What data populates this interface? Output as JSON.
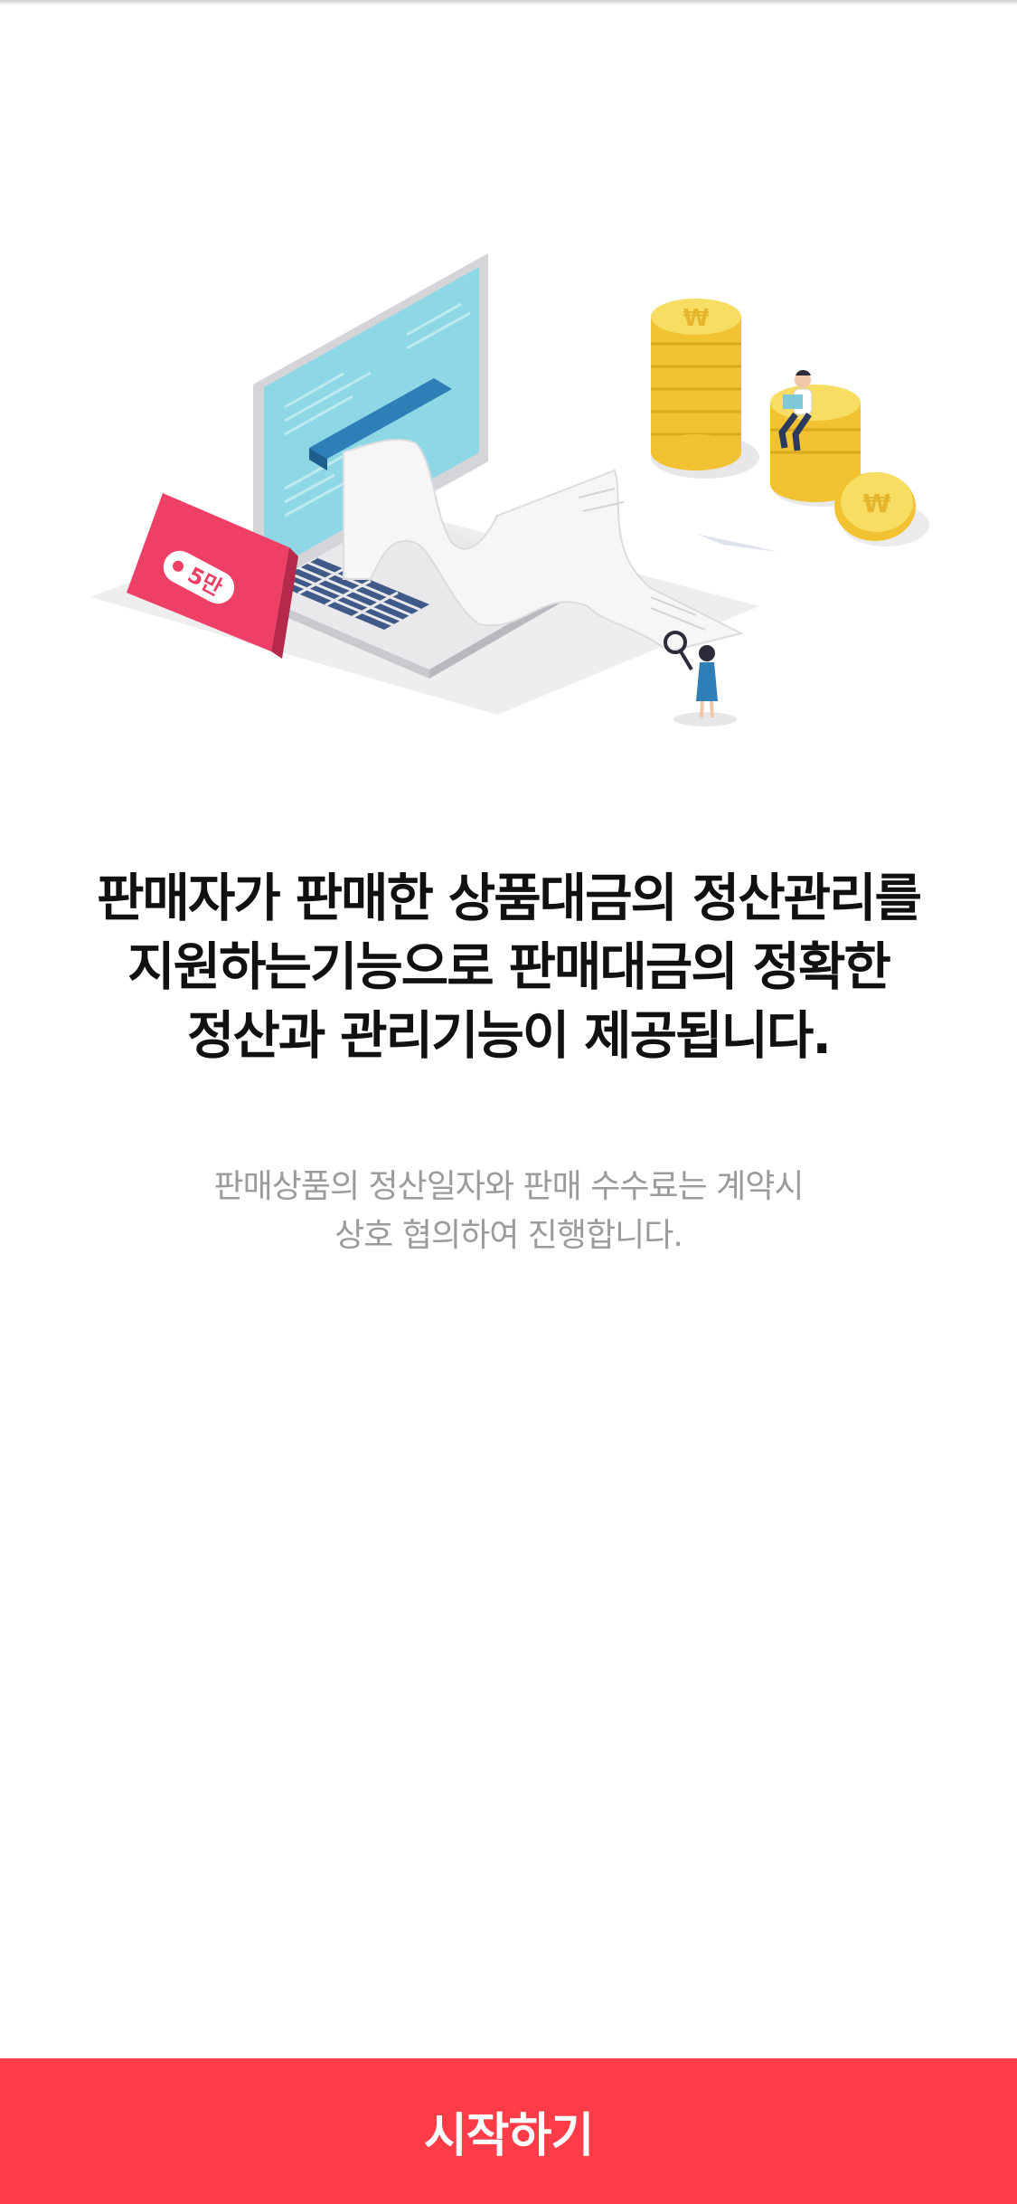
{
  "headline": {
    "line1": "판매자가 판매한 상품대금의 정산관리를",
    "line2": "지원하는기능으로 판매대금의 정확한",
    "line3": "정산과 관리기능이 제공됩니다."
  },
  "subtext": {
    "line1": "판매상품의 정산일자와 판매 수수료는 계약시",
    "line2": "상호 협의하여 진행합니다."
  },
  "illustration": {
    "price_tag_text": "5만",
    "coin_symbol": "₩"
  },
  "colors": {
    "accent": "#ff3c48",
    "screen": "#8ed8e6",
    "coin": "#f5d142",
    "tag": "#ee3f66"
  },
  "start_button": {
    "label": "시작하기"
  }
}
